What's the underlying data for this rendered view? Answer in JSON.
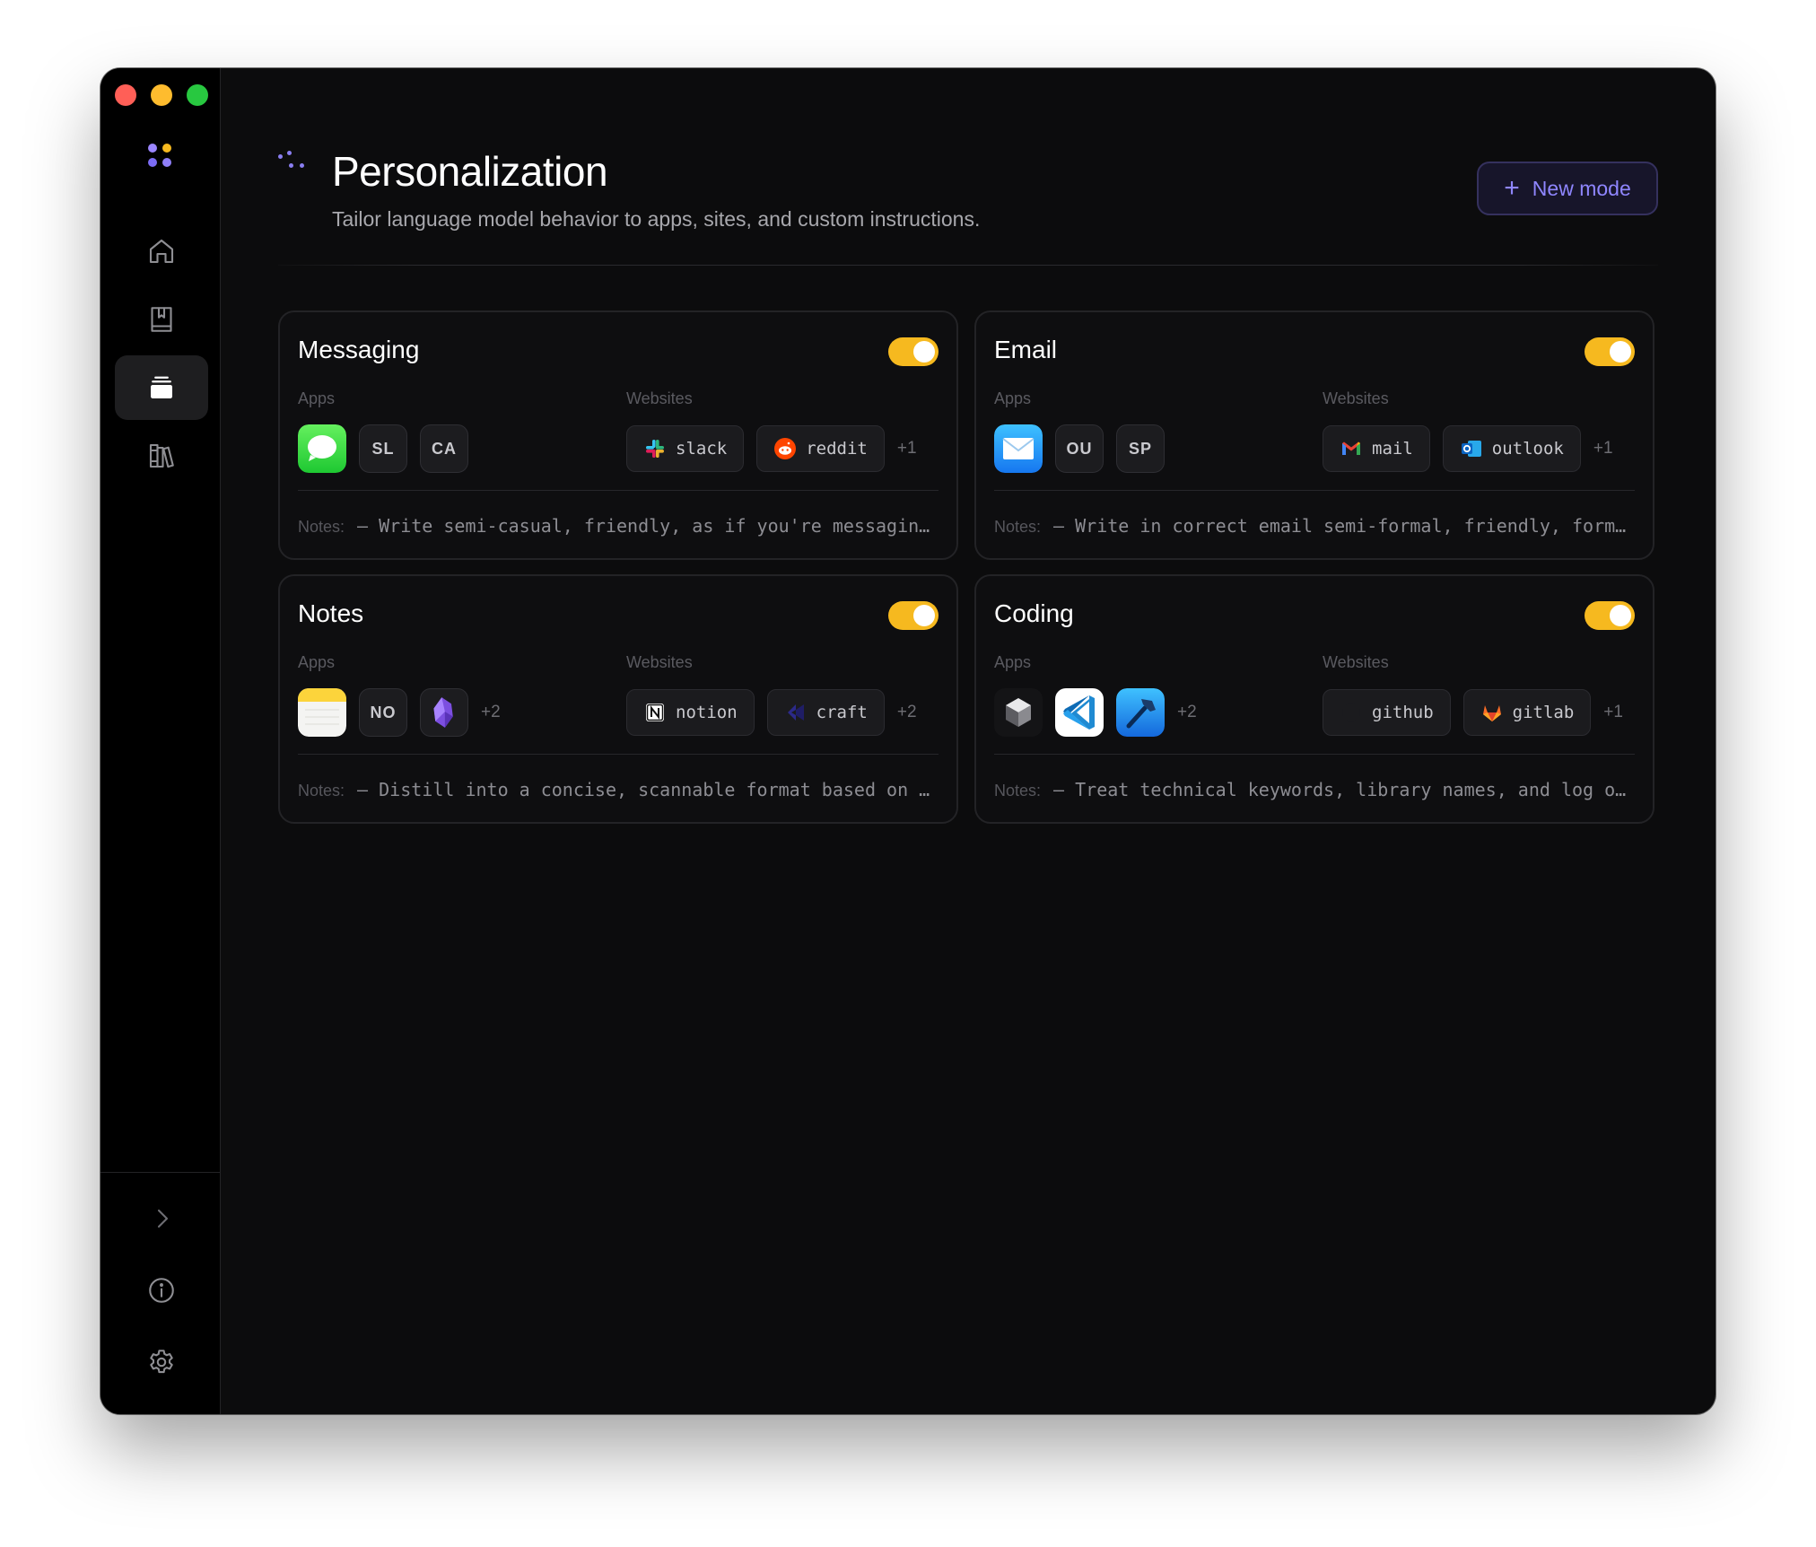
{
  "header": {
    "title": "Personalization",
    "subtitle": "Tailor language model behavior to apps, sites, and custom instructions.",
    "new_mode_label": "New mode"
  },
  "sidebar": {
    "items": [
      {
        "name": "home",
        "icon": "home-icon",
        "active": false
      },
      {
        "name": "dictionary",
        "icon": "book-bookmark-icon",
        "active": false
      },
      {
        "name": "modes",
        "icon": "stack-icon",
        "active": true
      },
      {
        "name": "library",
        "icon": "books-icon",
        "active": false
      }
    ],
    "bottom": [
      {
        "name": "expand",
        "icon": "chevron-right-icon"
      },
      {
        "name": "info",
        "icon": "info-icon"
      },
      {
        "name": "settings",
        "icon": "gear-icon"
      }
    ]
  },
  "labels": {
    "apps": "Apps",
    "websites": "Websites",
    "notes": "Notes:"
  },
  "modes": [
    {
      "title": "Messaging",
      "enabled": true,
      "apps": [
        {
          "icon": "messages-app-icon"
        },
        {
          "abbr": "SL"
        },
        {
          "abbr": "CA"
        }
      ],
      "apps_more": "",
      "websites": [
        {
          "icon": "slack-icon",
          "label": "slack"
        },
        {
          "icon": "reddit-icon",
          "label": "reddit"
        }
      ],
      "websites_more": "+1",
      "notes": "– Write semi-casual, friendly, as if you're messaging a friend or coworker"
    },
    {
      "title": "Email",
      "enabled": true,
      "apps": [
        {
          "icon": "mail-app-icon"
        },
        {
          "abbr": "OU"
        },
        {
          "abbr": "SP"
        }
      ],
      "apps_more": "",
      "websites": [
        {
          "icon": "gmail-icon",
          "label": "mail"
        },
        {
          "icon": "outlook-icon",
          "label": "outlook"
        }
      ],
      "websites_more": "+1",
      "notes": "– Write in correct email semi-formal, friendly, format"
    },
    {
      "title": "Notes",
      "enabled": true,
      "apps": [
        {
          "icon": "notes-app-icon"
        },
        {
          "abbr": "NO"
        },
        {
          "icon": "obsidian-app-icon"
        }
      ],
      "apps_more": "+2",
      "websites": [
        {
          "icon": "notion-icon",
          "label": "notion"
        },
        {
          "icon": "craft-icon",
          "label": "craft"
        }
      ],
      "websites_more": "+2",
      "notes": "– Distill into a concise, scannable format based on the content"
    },
    {
      "title": "Coding",
      "enabled": true,
      "apps": [
        {
          "icon": "cursor-app-icon"
        },
        {
          "icon": "vscode-app-icon"
        },
        {
          "icon": "xcode-app-icon"
        }
      ],
      "apps_more": "+2",
      "websites": [
        {
          "icon": "github-icon",
          "label": "github"
        },
        {
          "icon": "gitlab-icon",
          "label": "gitlab"
        }
      ],
      "websites_more": "+1",
      "notes": "– Treat technical keywords, library names, and log output verbatim"
    }
  ],
  "colors": {
    "accent": "#8f86ff",
    "toggle_on": "#f6b91f",
    "window_bg": "#0c0c0d",
    "sidebar_bg": "#000000"
  }
}
